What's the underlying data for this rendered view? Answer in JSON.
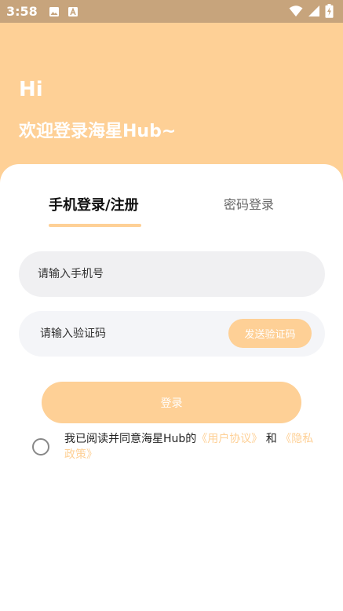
{
  "status_bar": {
    "time": "3:58",
    "left_icons": [
      "image-icon",
      "a-text-icon"
    ],
    "right_icons": [
      "wifi-icon",
      "signal-icon",
      "battery-icon"
    ],
    "background": "#c7a47c"
  },
  "header": {
    "greeting": "Hi",
    "welcome": "欢迎登录海星Hub~",
    "background": "#fed096"
  },
  "tabs": {
    "phone_login": "手机登录/注册",
    "password_login": "密码登录",
    "active": "phone_login"
  },
  "form": {
    "phone_placeholder": "请输入手机号",
    "phone_value": "",
    "code_placeholder": "请输入验证码",
    "code_value": "",
    "send_code_label": "发送验证码",
    "login_label": "登录"
  },
  "agreement": {
    "checked": false,
    "prefix": "我已阅读并同意海星Hub的",
    "user_agreement": "《用户协议》",
    "conjunction": " 和 ",
    "privacy_policy": "《隐私政策》"
  },
  "colors": {
    "accent": "#fed096",
    "input_bg": "#f0f0f2",
    "text_dark": "#111111",
    "text_muted": "#666666"
  }
}
